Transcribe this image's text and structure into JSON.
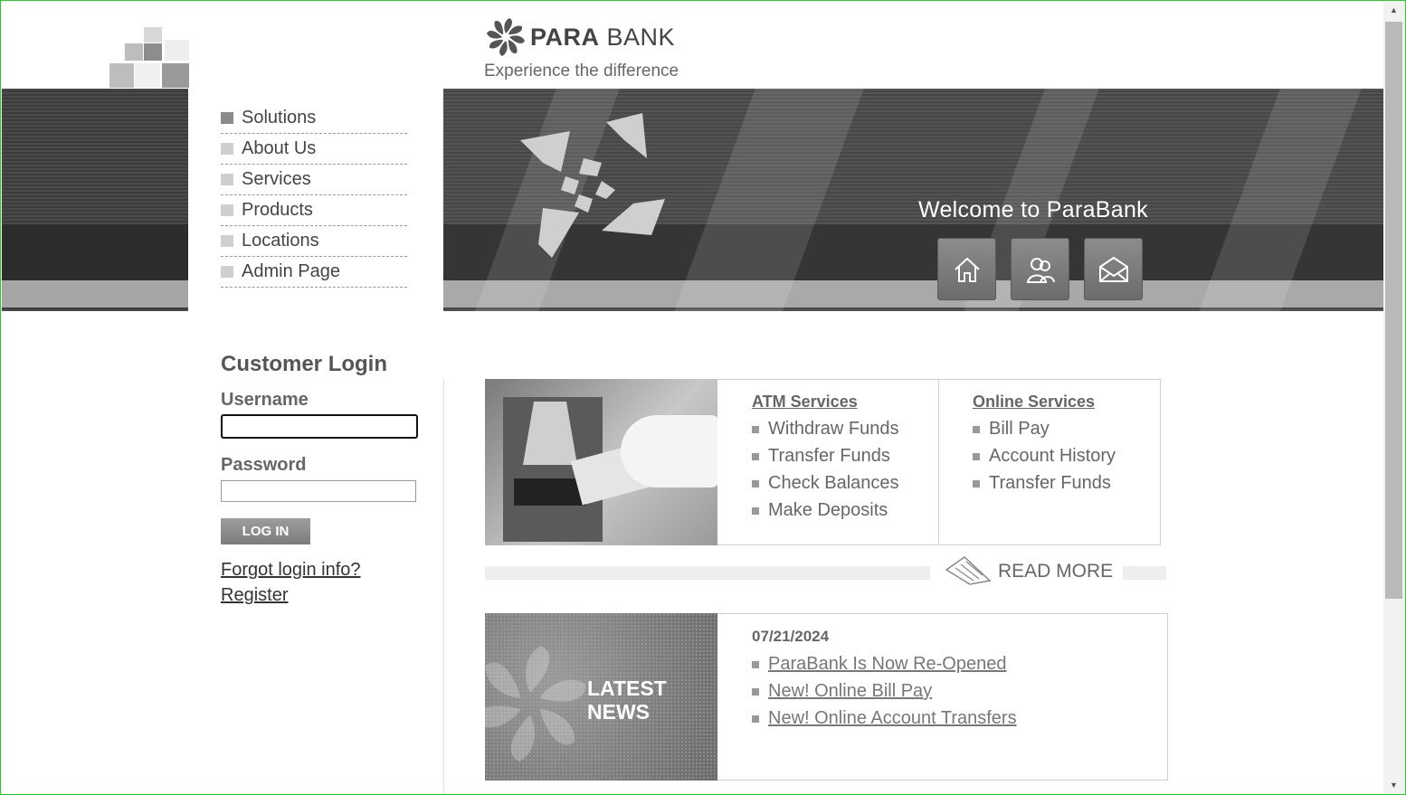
{
  "header": {
    "brand_bold": "PARA",
    "brand_light": " BANK",
    "tagline": "Experience the difference",
    "welcome": "Welcome to ParaBank",
    "buttons": [
      {
        "icon": "home-icon"
      },
      {
        "icon": "about-users-icon"
      },
      {
        "icon": "contact-mail-icon"
      }
    ]
  },
  "menu": {
    "items": [
      {
        "label": "Solutions",
        "active": true
      },
      {
        "label": "About Us"
      },
      {
        "label": "Services"
      },
      {
        "label": "Products"
      },
      {
        "label": "Locations"
      },
      {
        "label": "Admin Page"
      }
    ]
  },
  "login": {
    "title": "Customer Login",
    "username_label": "Username",
    "username_value": "",
    "password_label": "Password",
    "password_value": "",
    "button": "LOG IN",
    "forgot": "Forgot login info?",
    "register": "Register"
  },
  "services": {
    "atm_title": "ATM Services",
    "atm_items": [
      "Withdraw Funds",
      "Transfer Funds",
      "Check Balances",
      "Make Deposits"
    ],
    "online_title": "Online Services",
    "online_items": [
      "Bill Pay",
      "Account History",
      "Transfer Funds"
    ],
    "read_more": "READ MORE"
  },
  "news": {
    "image_title_1": "LATEST",
    "image_title_2": "NEWS",
    "date": "07/21/2024",
    "items": [
      "ParaBank Is Now Re-Opened",
      "New! Online Bill Pay",
      "New! Online Account Transfers"
    ]
  }
}
